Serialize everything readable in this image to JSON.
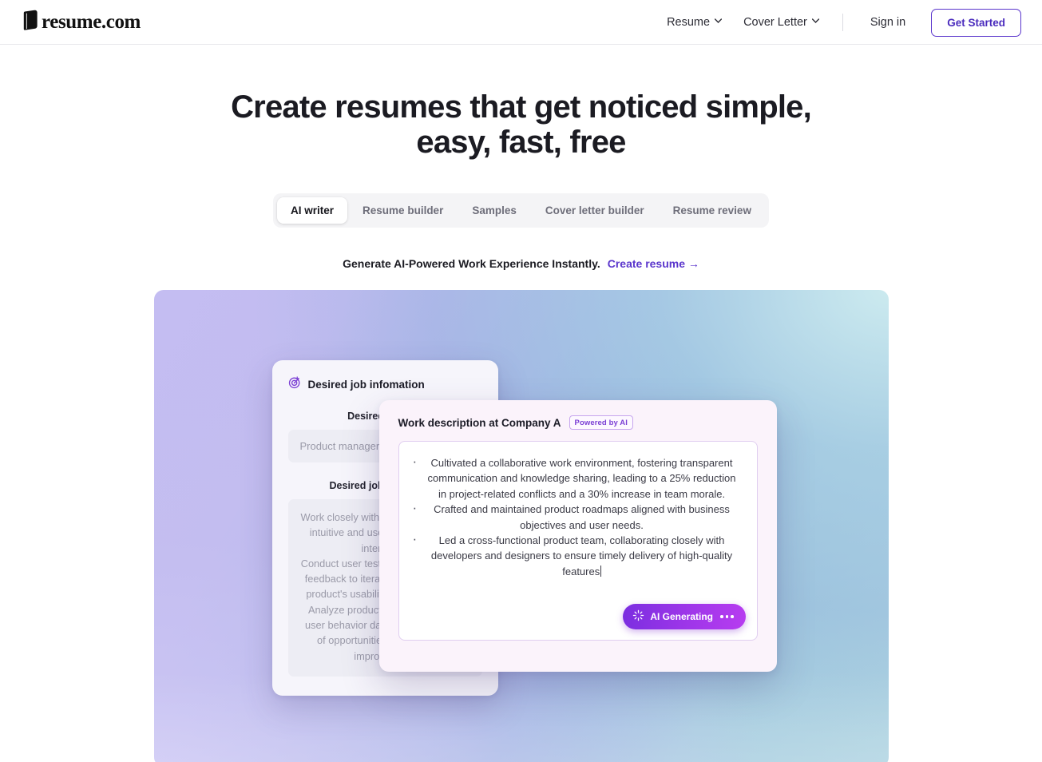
{
  "header": {
    "logo_text": "resume.com",
    "logo_icon": "book-icon",
    "nav": [
      {
        "label": "Resume",
        "icon": "chevron-down-icon"
      },
      {
        "label": "Cover Letter",
        "icon": "chevron-down-icon"
      }
    ],
    "signin_label": "Sign in",
    "get_started_label": "Get Started"
  },
  "hero": {
    "headline": "Create resumes that get noticed simple, easy, fast, free",
    "tabs": [
      {
        "label": "AI writer",
        "active": true
      },
      {
        "label": "Resume builder",
        "active": false
      },
      {
        "label": "Samples",
        "active": false
      },
      {
        "label": "Cover letter builder",
        "active": false
      },
      {
        "label": "Resume review",
        "active": false
      }
    ],
    "subline": "Generate AI-Powered Work Experience Instantly.",
    "cta_label": "Create resume →"
  },
  "preview": {
    "back_card": {
      "icon": "target-goal-icon",
      "title": "Desired job infomation",
      "job_title_label": "Desired job title",
      "job_title_value": "Product manager",
      "job_desc_label": "Desired job description",
      "job_desc_value": "Work closely with designers to create intuitive and user-friendly product interfaces.\nConduct user testing and gather user feedback to iterate and improve the product's usability and satisfaction.\nAnalyze product performance and user behavior data to identify areas of opportunities, and areas for improvement."
    },
    "front_card": {
      "title": "Work description at Company A",
      "badge": "Powered by AI",
      "bullets": [
        "Cultivated a collaborative work environment, fostering transparent communication and knowledge sharing, leading to a 25% reduction in project-related conflicts and a 30% increase in team morale.",
        "Crafted and maintained product roadmaps aligned with business objectives and user needs.",
        "Led a cross-functional product team, collaborating closely with developers and designers to ensure timely delivery of high-quality features"
      ],
      "generate_button": {
        "label": "AI Generating",
        "icon": "sparkle-icon",
        "trailing": "loading-dots"
      }
    }
  },
  "colors": {
    "brand_purple": "#5a35cc",
    "accent_violet": "#7b3fd4",
    "text_dark": "#1b1b22",
    "muted": "#9a9aa8"
  }
}
